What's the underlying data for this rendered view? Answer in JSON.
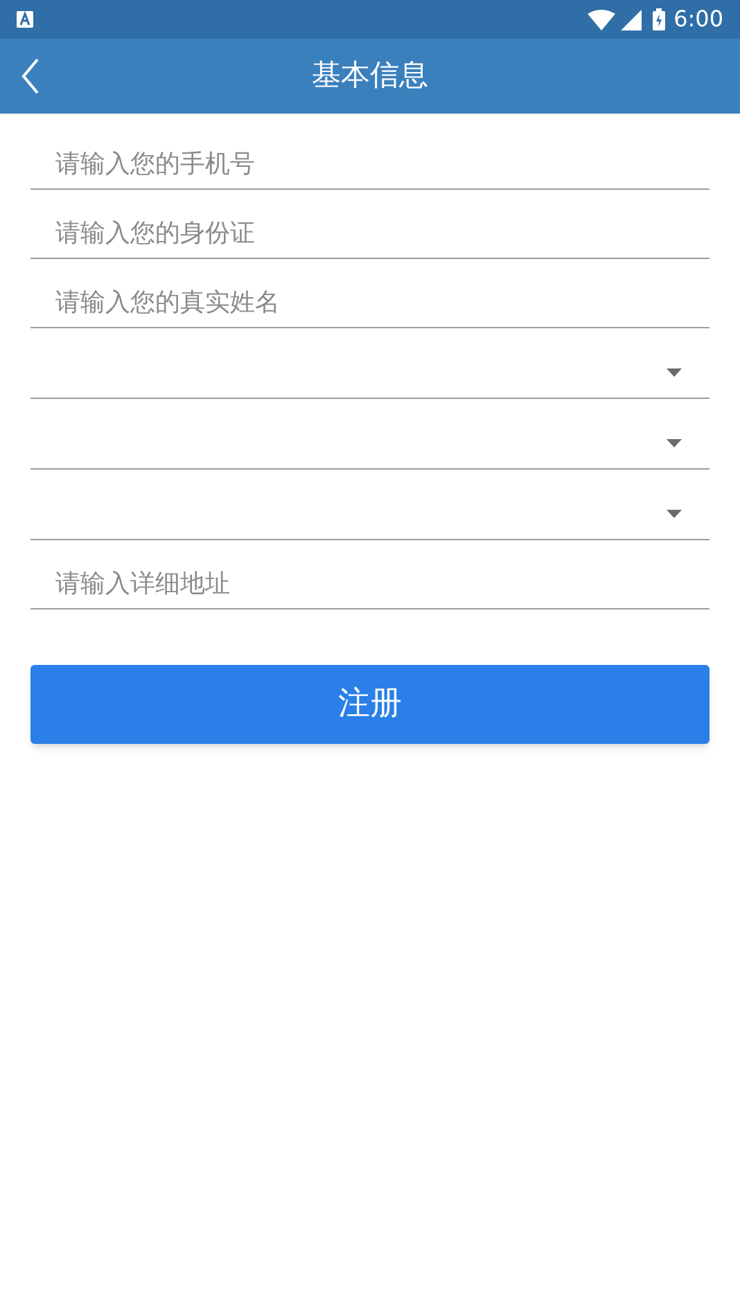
{
  "status_bar": {
    "time": "6:00"
  },
  "app_bar": {
    "title": "基本信息"
  },
  "fields": [
    {
      "kind": "input",
      "placeholder": "请输入您的手机号"
    },
    {
      "kind": "input",
      "placeholder": "请输入您的身份证"
    },
    {
      "kind": "input",
      "placeholder": "请输入您的真实姓名"
    },
    {
      "kind": "select"
    },
    {
      "kind": "select"
    },
    {
      "kind": "select"
    },
    {
      "kind": "input",
      "placeholder": "请输入详细地址"
    }
  ],
  "submit_button": {
    "label": "注册"
  }
}
